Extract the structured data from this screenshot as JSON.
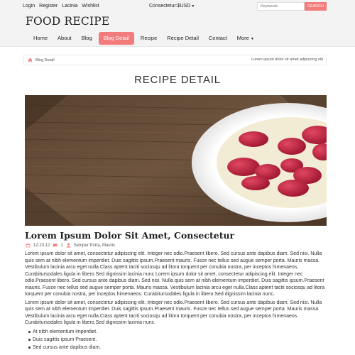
{
  "topbar": {
    "links": [
      "Login",
      "Register",
      "Lacinia",
      "Wishlist"
    ],
    "currency": "Consectetur:$USD",
    "search_placeholder": "Keywords",
    "search_button": "SEARCH"
  },
  "header": {
    "brand": "FOOD RECIPE",
    "nav": [
      {
        "label": "Home"
      },
      {
        "label": "About"
      },
      {
        "label": "Blog"
      },
      {
        "label": "Blog Detail",
        "active": true
      },
      {
        "label": "Recipe"
      },
      {
        "label": "Recipe Detail"
      },
      {
        "label": "Contact"
      },
      {
        "label": "More"
      }
    ]
  },
  "breadcrumb": {
    "current": "Blog Detail",
    "right_text": "Lorem ipsum dolor sit amet adipiscing elit"
  },
  "page": {
    "title": "RECIPE DETAIL"
  },
  "post": {
    "title": "Lorem Ipsum Dolor Sit Amet, Consectetur",
    "date": "12.23.12",
    "comments": "1",
    "author": "Semper Porta, Mauris",
    "paragraphs": [
      "Lorem ipsum dolor sit amet, consectetur adipiscing elit. Integer nec odio.Praesent libero. Sed cursus ante dapibus diam. Sed nisi. Nulla quis sem at nibh elementum imperdiet. Duis sagittis ipsum.Praesent mauris. Fusce nec tellus sed augue semper porta. Mauris massa. Vestibulum lacinia arcu eget nulla.Class aptent taciti sociosqu ad litora torquent per conubia nostra, per inceptos himenaeos. Curabitursodales ligula in libero.Sed dignissim lacinia nunc Lorem ipsum dolor sit amet, consectetur adipiscing elit. Integer nec odio.Praesent libero. Sed cursus ante dapibus diam. Sed nisi. Nulla quis sem at nibh elementum imperdiet. Duis sagittis ipsum.Praesent mauris. Fusce nec tellus sed augue semper porta. Mauris massa. Vestibulum lacinia arcu eget nulla.Class aptent taciti sociosqu ad litora torquent per conubia nostra, per inceptos himenaeos. Curabitursodales ligula in libero.Sed dignissim lacinia nunc.",
      "Lorem ipsum dolor sit amet, consectetur adipiscing elit. Integer nec odio.Praesent libero. Sed cursus ante dapibus diam. Sed nisi. Nulla quis sem at nibh elementum imperdiet. Duis sagittis ipsum.Praesent mauris. Fusce nec tellus sed augue semper porta. Mauris massa. Vestibulum lacinia arcu eget nulla.Class aptent taciti sociosqu ad litora torquent per conubia nostra, per inceptos himenaeos. Curabitursodales ligula in libero.Sed dignissim lacinia nunc."
    ],
    "list": [
      "At nibh elementum imperdiet.",
      "Duis sagittis ipsum Praesent.",
      "Sed cursus ante dapibus diam."
    ]
  },
  "colors": {
    "accent": "#f37b7b",
    "bar_bg": "#f3f3f3"
  },
  "icons": {
    "home": "home-icon",
    "date": "calendar-icon",
    "comments": "comment-icon",
    "author": "user-icon"
  }
}
